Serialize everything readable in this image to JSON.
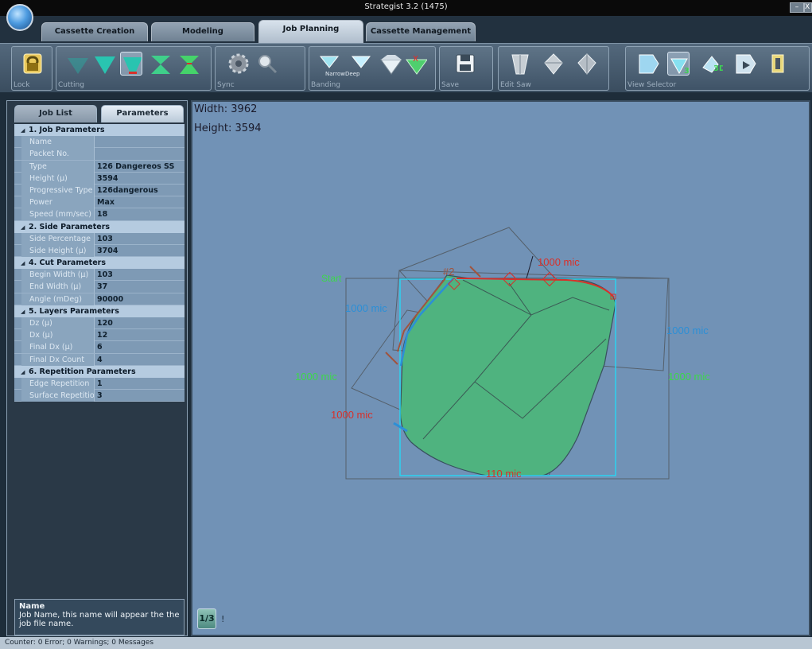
{
  "window": {
    "title": "Strategist 3.2 (1475)"
  },
  "tabs": [
    "Cassette Creation",
    "Modeling",
    "Job Planning",
    "Cassette Management"
  ],
  "ribbon": {
    "groups": {
      "lock": "Lock",
      "cutting": "Cutting",
      "sync": "Sync",
      "banding": "Banding",
      "banding_narrow_deep": "NarrowDeep",
      "save": "Save",
      "edit_saw": "Edit Saw",
      "view_selector": "View Selector"
    }
  },
  "left_panel": {
    "tabs": {
      "job_list": "Job List",
      "parameters": "Parameters"
    },
    "sections": [
      {
        "title": "1. Job Parameters",
        "rows": [
          {
            "k": "Name",
            "v": ""
          },
          {
            "k": "Packet No.",
            "v": ""
          },
          {
            "k": "Type",
            "v": "126 Dangereos SS"
          },
          {
            "k": "Height (µ)",
            "v": "3594"
          },
          {
            "k": "Progressive Type",
            "v": "126dangerous"
          },
          {
            "k": "Power",
            "v": "Max"
          },
          {
            "k": "Speed (mm/sec)",
            "v": "18"
          }
        ]
      },
      {
        "title": "2. Side Parameters",
        "rows": [
          {
            "k": "Side Percentage",
            "v": "103"
          },
          {
            "k": "Side Height (µ)",
            "v": "3704"
          }
        ]
      },
      {
        "title": "4. Cut Parameters",
        "rows": [
          {
            "k": "Begin Width (µ)",
            "v": "103"
          },
          {
            "k": "End Width (µ)",
            "v": "37"
          },
          {
            "k": "Angle (mDeg)",
            "v": "90000"
          }
        ]
      },
      {
        "title": "5. Layers Parameters",
        "rows": [
          {
            "k": "Dz (µ)",
            "v": "120"
          },
          {
            "k": "Dx (µ)",
            "v": "12"
          },
          {
            "k": "Final Dx (µ)",
            "v": "6"
          },
          {
            "k": "Final Dx Count",
            "v": "4"
          }
        ]
      },
      {
        "title": "6. Repetition Parameters",
        "rows": [
          {
            "k": "Edge Repetition",
            "v": "1"
          },
          {
            "k": "Surface Repetition",
            "v": "3"
          }
        ]
      }
    ],
    "description": {
      "title": "Name",
      "text": "Job Name, this name will appear the the job file name."
    }
  },
  "canvas": {
    "width_label": "Width: 3962",
    "height_label": "Height: 3594",
    "annotations": {
      "start": "Start",
      "cut_id": "#2",
      "top": "1000 mic",
      "left_blue": "1000 mic",
      "right_blue": "1000 mic",
      "left_green": "1000 mic",
      "right_green": "1000 mic",
      "left_red": "1000 mic",
      "bottom": "110 mic"
    },
    "colors": {
      "fill": "#4fb37f",
      "frame": "#2ad3f0",
      "red": "#d8302a",
      "blue": "#2c8fd6",
      "green": "#3cd84a"
    }
  },
  "status": "Counter: 0 Error; 0 Warnings; 0 Messages"
}
